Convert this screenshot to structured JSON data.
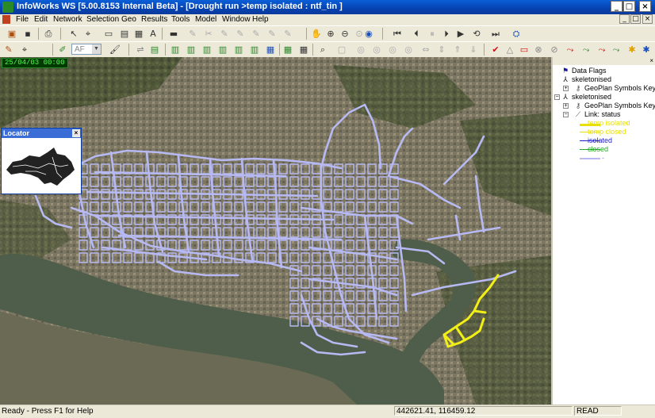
{
  "window": {
    "title": "InfoWorks WS [5.00.8153 Internal Beta] - [Drought run >temp isolated  : ntf_tin ]",
    "controls": [
      "_",
      "□",
      "×"
    ]
  },
  "menu": {
    "items": [
      "File",
      "Edit",
      "Network",
      "Selection",
      "Geo",
      "Results",
      "Tools",
      "Model",
      "Window",
      "Help"
    ],
    "mdi_controls": [
      "_",
      "□",
      "×"
    ]
  },
  "toolbar2": {
    "combo_value": "AF"
  },
  "map": {
    "time": "25/04/03 00:00",
    "network_color": "#b7b9f3",
    "highlight_color": "#f2ee18"
  },
  "locator": {
    "title": "Locator",
    "close": "×"
  },
  "tree": {
    "items": [
      {
        "label": "Data Flags",
        "icon": "flag-icon"
      },
      {
        "label": "skeletonised",
        "icon": "network-icon"
      },
      {
        "label": "GeoPlan Symbols Key",
        "icon": "key-icon"
      },
      {
        "label": "skeletonised",
        "icon": "network-icon"
      },
      {
        "label": "GeoPlan Symbols Key",
        "icon": "key-icon"
      },
      {
        "label": "Link: status",
        "icon": "link-icon"
      }
    ],
    "legend": [
      {
        "label": "temp isolated",
        "color": "#e8e000"
      },
      {
        "label": "temp closed",
        "color": "#e8e000"
      },
      {
        "label": "isolated",
        "color": "#2222cc"
      },
      {
        "label": "closed",
        "color": "#22aa22"
      },
      {
        "label": "-",
        "color": "#b7b9f3"
      }
    ]
  },
  "status": {
    "help": "Ready - Press F1 for Help",
    "coords": "442621.41, 116459.12",
    "mode": "READ"
  }
}
